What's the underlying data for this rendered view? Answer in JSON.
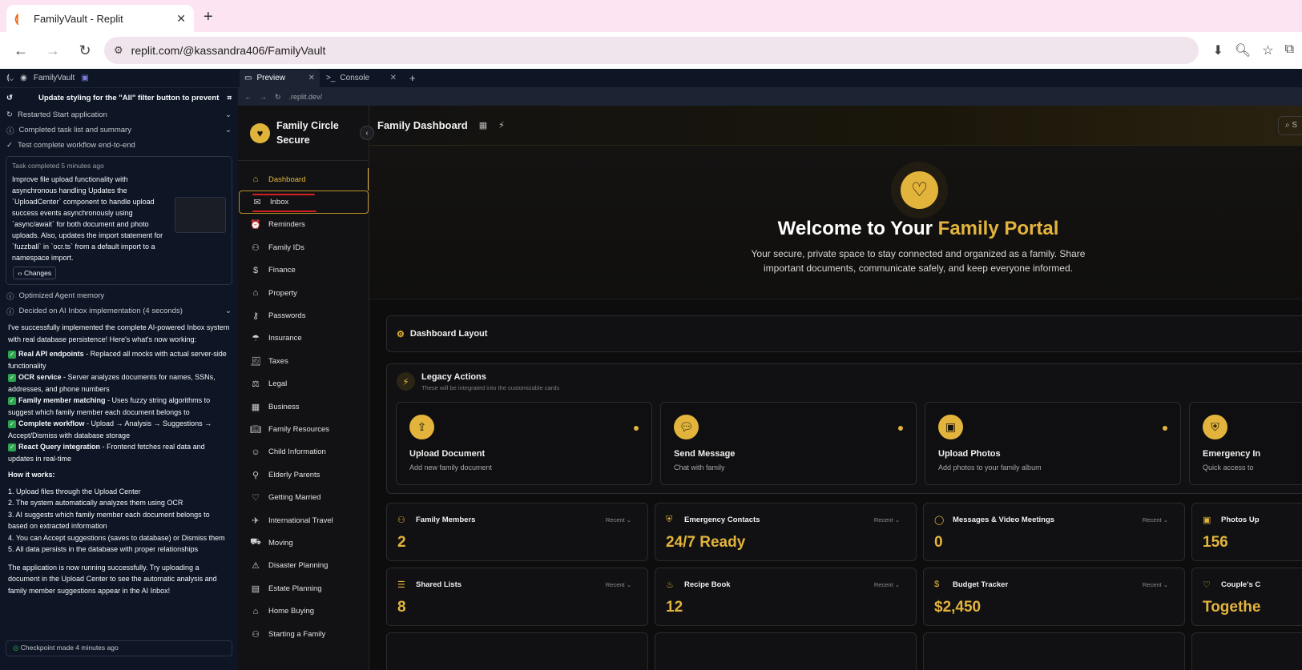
{
  "browser": {
    "tab_title": "FamilyVault - Replit",
    "url": "replit.com/@kassandra406/FamilyVault"
  },
  "replit": {
    "project_name": "FamilyVault",
    "preview_tab": "Preview",
    "console_tab": "Console",
    "preview_url": ".replit.dev/"
  },
  "agent": {
    "header": "Update styling for the \"All\" filter button to prevent ...",
    "steps": [
      {
        "label": "Restarted Start application"
      },
      {
        "label": "Completed task list and summary"
      },
      {
        "label": "Test complete workflow end-to-end"
      }
    ],
    "task_meta": "Task completed 5 minutes ago",
    "task_body": "Improve file upload functionality with asynchronous handling Updates the `UploadCenter` component to handle upload success events asynchronously using `async/await` for both document and photo uploads. Also, updates the import statement for `fuzzball` in `ocr.ts` from a default import to a namespace import.",
    "changes_label": "Changes",
    "memory_line": "Optimized Agent memory",
    "decided_line": "Decided on AI Inbox implementation (4 seconds)",
    "intro": "I've successfully implemented the complete AI-powered Inbox system with real database persistence! Here's what's now working:",
    "features": [
      {
        "title": "Real API endpoints",
        "text": " - Replaced all mocks with actual server-side functionality"
      },
      {
        "title": "OCR service",
        "text": " - Server analyzes documents for names, SSNs, addresses, and phone numbers"
      },
      {
        "title": "Family member matching",
        "text": " - Uses fuzzy string algorithms to suggest which family member each document belongs to"
      },
      {
        "title": "Complete workflow",
        "text": " - Upload → Analysis → Suggestions → Accept/Dismiss with database storage"
      },
      {
        "title": "React Query integration",
        "text": " - Frontend fetches real data and updates in real-time"
      }
    ],
    "how_title": "How it works:",
    "how_steps": [
      "1. Upload files through the Upload Center",
      "2. The system automatically analyzes them using OCR",
      "3. AI suggests which family member each document belongs to based on extracted information",
      "4. You can Accept suggestions (saves to database) or Dismiss them",
      "5. All data persists in the database with proper relationships"
    ],
    "outro": "The application is now running successfully. Try uploading a document in the Upload Center to see the automatic analysis and family member suggestions appear in the AI Inbox!",
    "checkpoint": "Checkpoint made 4 minutes ago"
  },
  "app": {
    "brand": "Family Circle Secure",
    "nav": [
      {
        "label": "Dashboard",
        "icon": "home-icon"
      },
      {
        "label": "Inbox",
        "icon": "inbox-icon"
      },
      {
        "label": "Reminders",
        "icon": "alarm-icon"
      },
      {
        "label": "Family IDs",
        "icon": "users-icon"
      },
      {
        "label": "Finance",
        "icon": "dollar-icon"
      },
      {
        "label": "Property",
        "icon": "house-icon"
      },
      {
        "label": "Passwords",
        "icon": "key-icon"
      },
      {
        "label": "Insurance",
        "icon": "umbrella-icon"
      },
      {
        "label": "Taxes",
        "icon": "receipt-icon"
      },
      {
        "label": "Legal",
        "icon": "scale-icon"
      },
      {
        "label": "Business",
        "icon": "building-icon"
      },
      {
        "label": "Family Resources",
        "icon": "book-icon"
      },
      {
        "label": "Child Information",
        "icon": "baby-icon"
      },
      {
        "label": "Elderly Parents",
        "icon": "user-icon"
      },
      {
        "label": "Getting Married",
        "icon": "heart-icon"
      },
      {
        "label": "International Travel",
        "icon": "plane-icon"
      },
      {
        "label": "Moving",
        "icon": "truck-icon"
      },
      {
        "label": "Disaster Planning",
        "icon": "warning-icon"
      },
      {
        "label": "Estate Planning",
        "icon": "file-icon"
      },
      {
        "label": "Home Buying",
        "icon": "house-icon"
      },
      {
        "label": "Starting a Family",
        "icon": "users-icon"
      }
    ],
    "page_title": "Family Dashboard",
    "search_placeholder": "S",
    "hero_title_a": "Welcome to Your ",
    "hero_title_b": "Family Portal",
    "hero_sub": "Your secure, private space to stay connected and organized as a family. Share important documents, communicate safely, and keep everyone informed.",
    "layout_label": "Dashboard Layout",
    "legacy_title": "Legacy Actions",
    "legacy_sub": "These will be integrated into the customizable cards",
    "actions": [
      {
        "title": "Upload Document",
        "sub": "Add new family document",
        "icon": "upload-icon"
      },
      {
        "title": "Send Message",
        "sub": "Chat with family",
        "icon": "chat-icon"
      },
      {
        "title": "Upload Photos",
        "sub": "Add photos to your family album",
        "icon": "image-icon"
      },
      {
        "title": "Emergency In",
        "sub": "Quick access to",
        "icon": "shield-icon"
      }
    ],
    "stats": [
      {
        "title": "Family Members",
        "value": "2",
        "recent": "Recent",
        "icon": "users-icon"
      },
      {
        "title": "Emergency Contacts",
        "value": "24/7 Ready",
        "recent": "Recent",
        "icon": "shield-icon"
      },
      {
        "title": "Messages & Video Meetings",
        "value": "0",
        "recent": "Recent",
        "icon": "chat-icon"
      },
      {
        "title": "Photos Up",
        "value": "156",
        "recent": "",
        "icon": "image-icon"
      },
      {
        "title": "Shared Lists",
        "value": "8",
        "recent": "Recent",
        "icon": "list-icon"
      },
      {
        "title": "Recipe Book",
        "value": "12",
        "recent": "Recent",
        "icon": "chef-icon"
      },
      {
        "title": "Budget Tracker",
        "value": "$2,450",
        "recent": "Recent",
        "icon": "dollar-icon"
      },
      {
        "title": "Couple's C",
        "value": "Togethe",
        "recent": "",
        "icon": "heart-icon"
      }
    ]
  },
  "colors": {
    "accent": "#e3b43c",
    "bg": "#0d0d0e",
    "chrome": "#fce4f3"
  }
}
